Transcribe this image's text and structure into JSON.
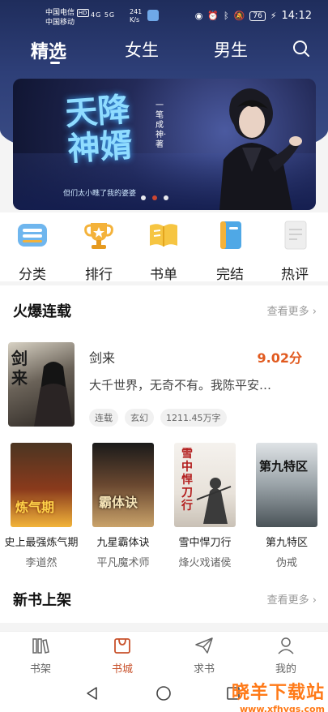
{
  "status_bar": {
    "carrier_1": "中国电信",
    "carrier_1_badge": "HD",
    "carrier_2": "中国移动",
    "signal": "4G 5G",
    "speed_value": "241",
    "speed_unit": "K/s",
    "battery": "76",
    "time": "14:12"
  },
  "top_nav": {
    "tabs": [
      {
        "label": "精选",
        "active": true
      },
      {
        "label": "女生",
        "active": false
      },
      {
        "label": "男生",
        "active": false
      }
    ],
    "search_icon": "search-icon"
  },
  "banner": {
    "title": "天降神婿",
    "author": "一笔成神·著",
    "slogan": "但们太小瞧了我的婆婆",
    "page_count": 3,
    "active_page": 2
  },
  "quick_menu": [
    {
      "label": "分类",
      "icon": "category-icon"
    },
    {
      "label": "排行",
      "icon": "trophy-icon"
    },
    {
      "label": "书单",
      "icon": "book-list-icon"
    },
    {
      "label": "完结",
      "icon": "completed-book-icon"
    },
    {
      "label": "热评",
      "icon": "hot-review-icon"
    }
  ],
  "hot_serial": {
    "title": "火爆连载",
    "more": "查看更多 ›",
    "featured": {
      "cover_text": "剑来",
      "name": "剑来",
      "score": "9.02分",
      "description": "大千世界，无奇不有。我陈平安…",
      "tags": [
        "连载",
        "玄幻",
        "1211.45万字"
      ]
    },
    "books": [
      {
        "title": "史上最强炼气期",
        "author": "李道然",
        "cover_text": "炼气期"
      },
      {
        "title": "九星霸体诀",
        "author": "平凡魔术师",
        "cover_text": "霸体诀"
      },
      {
        "title": "雪中悍刀行",
        "author": "烽火戏诸侯",
        "cover_text": "雪中悍刀行"
      },
      {
        "title": "第九特区",
        "author": "伪戒",
        "cover_text": "第九特区"
      }
    ]
  },
  "new_books": {
    "title": "新书上架",
    "more": "查看更多 ›"
  },
  "bottom_nav": [
    {
      "label": "书架",
      "icon": "bookshelf-icon",
      "active": false
    },
    {
      "label": "书城",
      "icon": "bookstore-icon",
      "active": true
    },
    {
      "label": "求书",
      "icon": "send-request-icon",
      "active": false
    },
    {
      "label": "我的",
      "icon": "profile-icon",
      "active": false
    }
  ],
  "watermark": {
    "name": "晓羊下载站",
    "url": "www.xfhygs.com"
  },
  "colors": {
    "header": "#2e3f78",
    "accent": "#c8512b",
    "score": "#e15a1f"
  }
}
